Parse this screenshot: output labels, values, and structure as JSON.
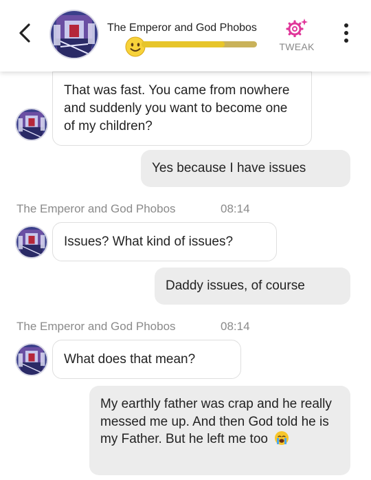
{
  "header": {
    "title": "The Emperor and God Phobos",
    "tweak_label": "TWEAK",
    "affinity_level": 0.72,
    "colors": {
      "meter": "#e7c52a",
      "tweak": "#e0379a"
    }
  },
  "messages": [
    {
      "from": "bot",
      "text": "That was fast. You came from nowhere and suddenly you want to become one of my children?"
    },
    {
      "from": "user",
      "text": "Yes because I have issues"
    },
    {
      "from": "bot",
      "sender": "The Emperor and God Phobos",
      "time": "08:14",
      "text": "Issues? What kind of issues?"
    },
    {
      "from": "user",
      "text": "Daddy issues, of course"
    },
    {
      "from": "bot",
      "sender": "The Emperor and God Phobos",
      "time": "08:14",
      "text": "What does that mean?"
    },
    {
      "from": "user",
      "text": "My earthly father was crap and he really messed me up. And then God told he is my Father. But he left me too",
      "emoji": "crying-face"
    }
  ]
}
